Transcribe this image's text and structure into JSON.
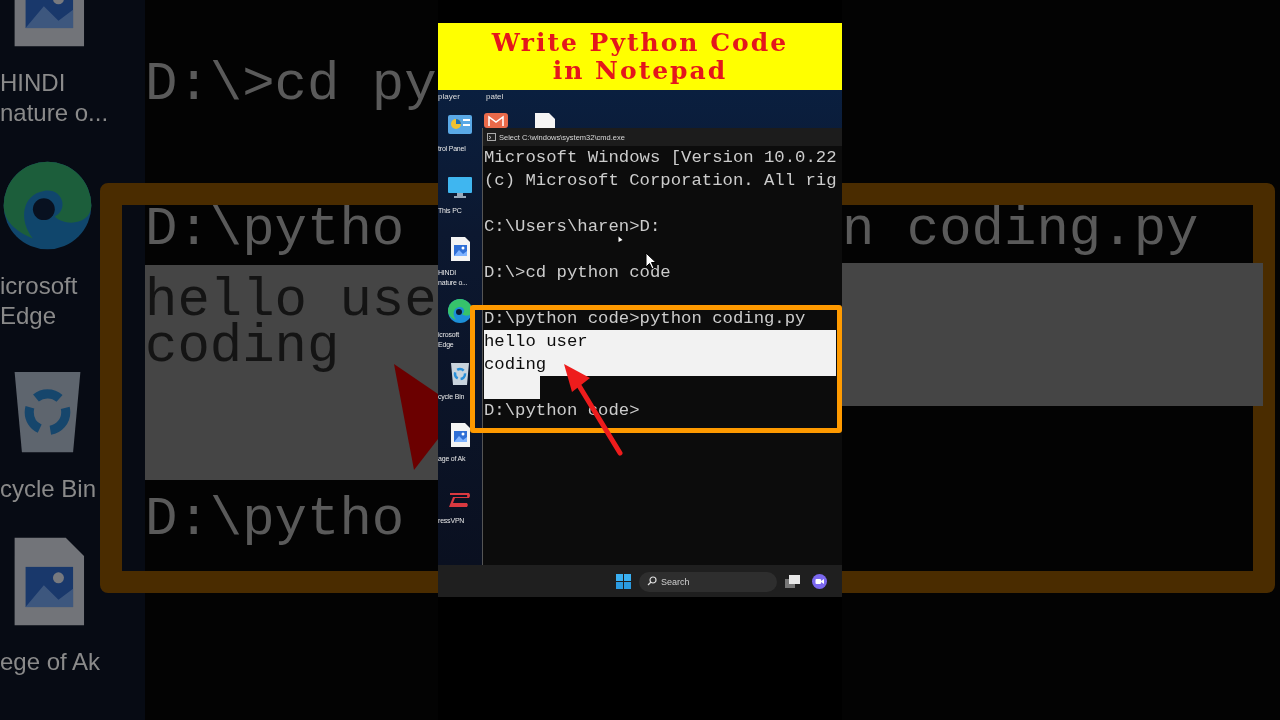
{
  "backdrop": {
    "left": {
      "icons": [
        {
          "kind": "image",
          "label": [
            "HINDI",
            "nature o..."
          ]
        },
        {
          "kind": "edge",
          "label": [
            "icrosoft",
            "Edge"
          ]
        },
        {
          "kind": "recycle-bin",
          "label": [
            "cycle Bin"
          ]
        },
        {
          "kind": "image",
          "label": [
            "ege of Ak"
          ]
        }
      ],
      "lines": [
        {
          "text": "D:\\>cd py",
          "highlighted": false
        },
        {
          "text": "D:\\pytho",
          "highlighted": false
        },
        {
          "text": "hello use",
          "highlighted": true
        },
        {
          "text": "coding",
          "highlighted": true
        },
        {
          "text": "D:\\pytho",
          "highlighted": false
        }
      ]
    },
    "right": {
      "lines": [
        {
          "text": "n coding.py",
          "highlighted": false
        }
      ]
    }
  },
  "banner": {
    "lines": [
      "Write Python Code",
      "in Notepad"
    ]
  },
  "desktop": {
    "top_labels": [
      "player",
      "patel"
    ],
    "icons": [
      {
        "kind": "control-panel",
        "label": [
          "trol Panel"
        ]
      },
      {
        "kind": "this-pc",
        "label": [
          "This PC"
        ]
      },
      {
        "kind": "image",
        "label": [
          "HINDI",
          "nature o..."
        ]
      },
      {
        "kind": "edge",
        "label": [
          "icrosoft",
          "Edge"
        ]
      },
      {
        "kind": "recycle-bin",
        "label": [
          "cycle Bin"
        ]
      },
      {
        "kind": "image",
        "label": [
          "age of Ak"
        ]
      },
      {
        "kind": "vpn",
        "label": [
          "ressVPN"
        ]
      }
    ]
  },
  "terminal": {
    "title": "Select C:\\windows\\system32\\cmd.exe",
    "lines": [
      {
        "text": "Microsoft Windows [Version 10.0.22",
        "highlighted": false
      },
      {
        "text": "(c) Microsoft Corporation. All rig",
        "highlighted": false
      },
      {
        "kind": "blank"
      },
      {
        "text": "C:\\Users\\haren>D:",
        "highlighted": false
      },
      {
        "kind": "blank"
      },
      {
        "text": "D:\\>cd python code",
        "highlighted": false
      },
      {
        "kind": "blank"
      },
      {
        "text": "D:\\python code>python coding.py",
        "highlighted": false
      },
      {
        "text": "hello user",
        "highlighted": true
      },
      {
        "text": "coding",
        "highlighted": true
      },
      {
        "kind": "blank",
        "highlighted": true
      },
      {
        "text": "D:\\python code>",
        "highlighted": false
      }
    ]
  },
  "taskbar": {
    "search": {
      "placeholder": "Search"
    }
  }
}
